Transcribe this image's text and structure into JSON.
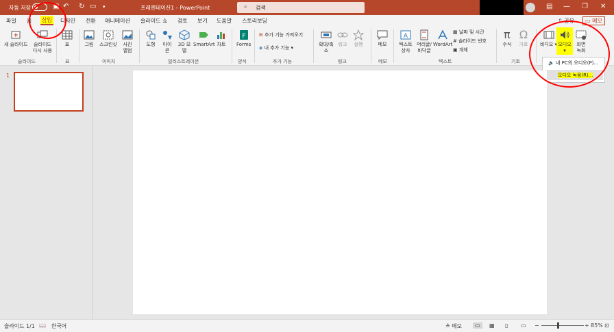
{
  "titlebar": {
    "autosave_label": "자동 저장",
    "autosave_state": "끔",
    "doc_title": "프레젠테이션1  -  PowerPoint",
    "search_placeholder": "검색"
  },
  "tabs": [
    "파일",
    "홈",
    "삽입",
    "디자인",
    "전환",
    "애니메이션",
    "슬라이드 쇼",
    "검토",
    "보기",
    "도움말",
    "스토리보딩"
  ],
  "share_label": "공유",
  "memo_label": "메모",
  "ribbon": {
    "groups": [
      {
        "label": "슬라이드",
        "buttons": [
          "새 슬라이드",
          "슬라이드 다시 사용"
        ]
      },
      {
        "label": "표",
        "buttons": [
          "표"
        ]
      },
      {
        "label": "이미지",
        "buttons": [
          "그림",
          "스크린샷",
          "사진 앨범"
        ]
      },
      {
        "label": "일러스트레이션",
        "buttons": [
          "도형",
          "아이콘",
          "3D 모델",
          "SmartArt",
          "차트"
        ]
      },
      {
        "label": "양식",
        "buttons": [
          "Forms"
        ]
      },
      {
        "label": "추가 기능",
        "buttons": [
          "추가 기능 가져오기",
          "내 추가 기능"
        ]
      },
      {
        "label": "링크",
        "buttons": [
          "확대/축소",
          "링크",
          "실행"
        ]
      },
      {
        "label": "메모",
        "buttons": [
          "메모"
        ]
      },
      {
        "label": "텍스트",
        "buttons": [
          "텍스트 상자",
          "머리글/바닥글",
          "WordArt",
          "날짜 및 시간",
          "슬라이드 번호",
          "개체"
        ]
      },
      {
        "label": "기호",
        "buttons": [
          "수식",
          "기호"
        ]
      },
      {
        "label": "",
        "buttons": [
          "비디오",
          "오디오",
          "화면 녹화"
        ]
      }
    ]
  },
  "dropdown": {
    "item1": "내 PC의 오디오(P)...",
    "item2": "오디오 녹음(R)..."
  },
  "slide_panel": {
    "slide_number": "1"
  },
  "statusbar": {
    "slide_info": "슬라이드 1/1",
    "language": "한국어",
    "notes": "메모",
    "zoom": "85%"
  },
  "colors": {
    "accent": "#b7472a",
    "highlight": "#ffff00",
    "annotation": "#ff0000"
  }
}
